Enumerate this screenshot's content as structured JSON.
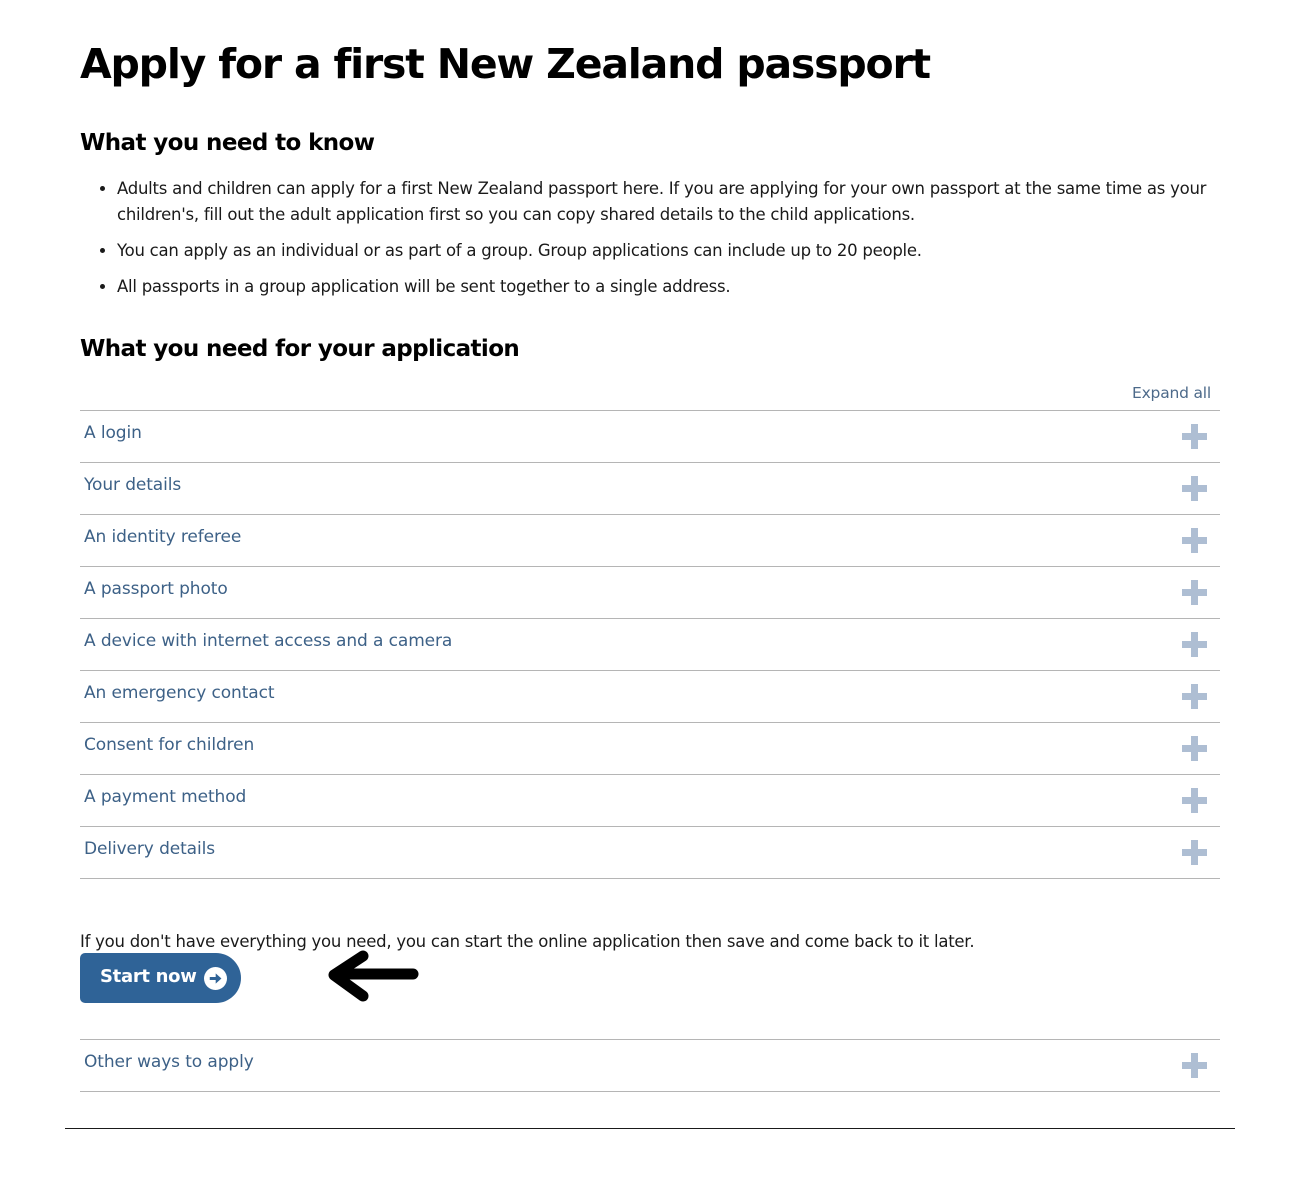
{
  "page": {
    "title": "Apply for a first New Zealand passport"
  },
  "know": {
    "heading": "What you need to know",
    "bullets": [
      "Adults and children can apply for a first New Zealand passport here. If you are applying for your own passport at the same time as your children's, fill out the adult application first so you can copy shared details to the child applications.",
      "You can apply as an individual or as part of a group. Group applications can include up to 20 people.",
      "All passports in a group application will be sent together to a single address."
    ]
  },
  "need": {
    "heading": "What you need for your application",
    "expand_all": "Expand all",
    "items": [
      "A login",
      "Your details",
      "An identity referee",
      "A passport photo",
      "A device with internet access and a camera",
      "An emergency contact",
      "Consent for children",
      "A payment method",
      "Delivery details"
    ]
  },
  "start": {
    "note": "If you don't have everything you need, you can start the online application then save and come back to it later.",
    "button_label": "Start now",
    "button_icon": "arrow-circle-right-icon",
    "annotation_icon": "pointer-arrow-left-icon"
  },
  "other": {
    "label": "Other ways to apply"
  },
  "colors": {
    "link": "#3d6187",
    "button": "#2f6397",
    "plus": "#aebed3",
    "rule": "#b5b5b5"
  }
}
